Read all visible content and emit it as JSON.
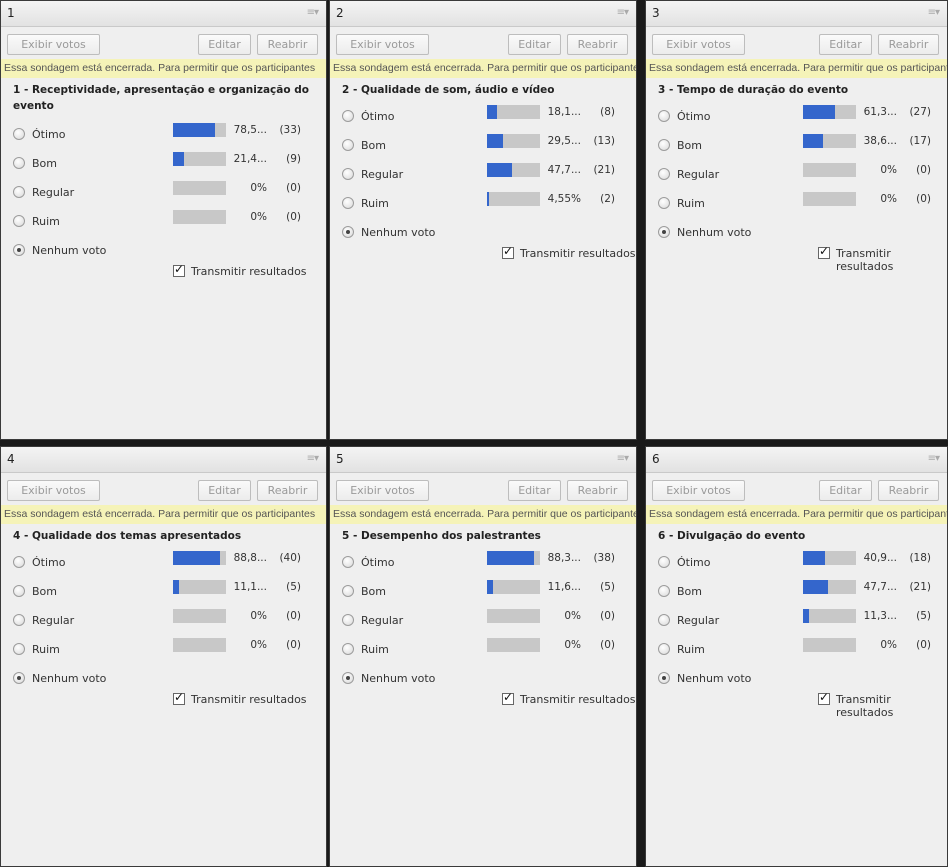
{
  "buttons": {
    "votos": "Exibir votos",
    "editar": "Editar",
    "reabrir": "Reabrir"
  },
  "notice": "Essa sondagem está encerrada. Para permitir que os participantes",
  "menu_glyph": "≡▾",
  "transmit_label": "Transmitir resultados",
  "colors": {
    "bar_fill": "#3466cc",
    "bar_bg": "#c8c8c8",
    "notice_bg": "#f5f3b8"
  },
  "pods": [
    {
      "title": "1",
      "question": "1 - Receptividade, apresentação e organização do evento",
      "options": [
        {
          "label": "Ótimo",
          "pct": "78,5...",
          "count": "(33)",
          "fraction": 0.785
        },
        {
          "label": "Bom",
          "pct": "21,4...",
          "count": "(9)",
          "fraction": 0.214
        },
        {
          "label": "Regular",
          "pct": "0%",
          "count": "(0)",
          "fraction": 0
        },
        {
          "label": "Ruim",
          "pct": "0%",
          "count": "(0)",
          "fraction": 0
        }
      ],
      "none_label": "Nenhum voto"
    },
    {
      "title": "2",
      "question": "2 - Qualidade de som, áudio e vídeo",
      "options": [
        {
          "label": "Ótimo",
          "pct": "18,1...",
          "count": "(8)",
          "fraction": 0.181
        },
        {
          "label": "Bom",
          "pct": "29,5...",
          "count": "(13)",
          "fraction": 0.295
        },
        {
          "label": "Regular",
          "pct": "47,7...",
          "count": "(21)",
          "fraction": 0.477
        },
        {
          "label": "Ruim",
          "pct": "4,55%",
          "count": "(2)",
          "fraction": 0.0455
        }
      ],
      "none_label": "Nenhum voto"
    },
    {
      "title": "3",
      "question": "3 - Tempo de duração do evento",
      "options": [
        {
          "label": "Ótimo",
          "pct": "61,3...",
          "count": "(27)",
          "fraction": 0.613
        },
        {
          "label": "Bom",
          "pct": "38,6...",
          "count": "(17)",
          "fraction": 0.386
        },
        {
          "label": "Regular",
          "pct": "0%",
          "count": "(0)",
          "fraction": 0
        },
        {
          "label": "Ruim",
          "pct": "0%",
          "count": "(0)",
          "fraction": 0
        }
      ],
      "none_label": "Nenhum voto"
    },
    {
      "title": "4",
      "question": "4 - Qualidade dos temas apresentados",
      "options": [
        {
          "label": "Ótimo",
          "pct": "88,8...",
          "count": "(40)",
          "fraction": 0.888
        },
        {
          "label": "Bom",
          "pct": "11,1...",
          "count": "(5)",
          "fraction": 0.111
        },
        {
          "label": "Regular",
          "pct": "0%",
          "count": "(0)",
          "fraction": 0
        },
        {
          "label": "Ruim",
          "pct": "0%",
          "count": "(0)",
          "fraction": 0
        }
      ],
      "none_label": "Nenhum voto"
    },
    {
      "title": "5",
      "question": "5 - Desempenho dos palestrantes",
      "options": [
        {
          "label": "Ótimo",
          "pct": "88,3...",
          "count": "(38)",
          "fraction": 0.883
        },
        {
          "label": "Bom",
          "pct": "11,6...",
          "count": "(5)",
          "fraction": 0.116
        },
        {
          "label": "Regular",
          "pct": "0%",
          "count": "(0)",
          "fraction": 0
        },
        {
          "label": "Ruim",
          "pct": "0%",
          "count": "(0)",
          "fraction": 0
        }
      ],
      "none_label": "Nenhum voto"
    },
    {
      "title": "6",
      "question": "6 - Divulgação do evento",
      "options": [
        {
          "label": "Ótimo",
          "pct": "40,9...",
          "count": "(18)",
          "fraction": 0.409
        },
        {
          "label": "Bom",
          "pct": "47,7...",
          "count": "(21)",
          "fraction": 0.477
        },
        {
          "label": "Regular",
          "pct": "11,3...",
          "count": "(5)",
          "fraction": 0.113
        },
        {
          "label": "Ruim",
          "pct": "0%",
          "count": "(0)",
          "fraction": 0
        }
      ],
      "none_label": "Nenhum voto"
    }
  ]
}
